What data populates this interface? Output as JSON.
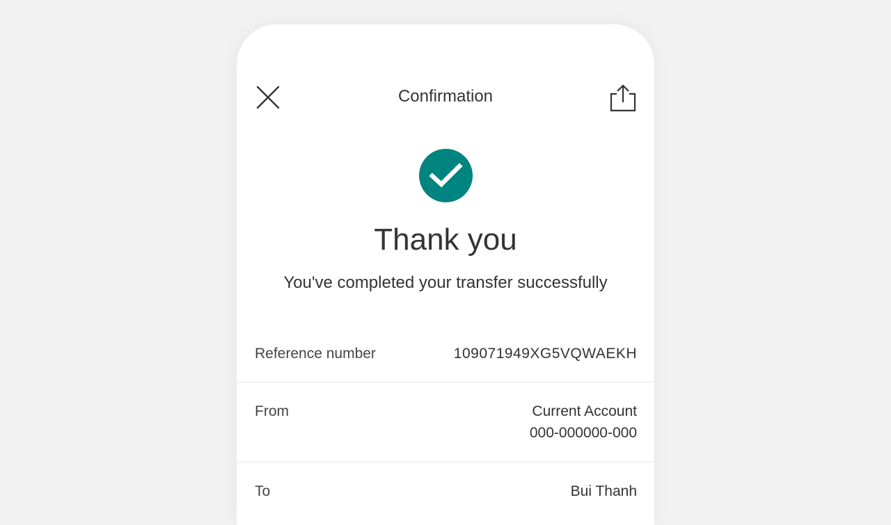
{
  "header": {
    "title": "Confirmation",
    "close_icon": "close-icon",
    "share_icon": "share-icon"
  },
  "status": {
    "icon": "check-circle-icon",
    "accent_color": "#00847f",
    "heading": "Thank you",
    "message": "You've completed your transfer successfully"
  },
  "details": {
    "reference": {
      "label": "Reference number",
      "value": "109071949XG5VQWAEKH"
    },
    "from": {
      "label": "From",
      "account_name": "Current Account",
      "account_number": "000-000000-000"
    },
    "to": {
      "label": "To",
      "name": "Bui Thanh"
    }
  }
}
